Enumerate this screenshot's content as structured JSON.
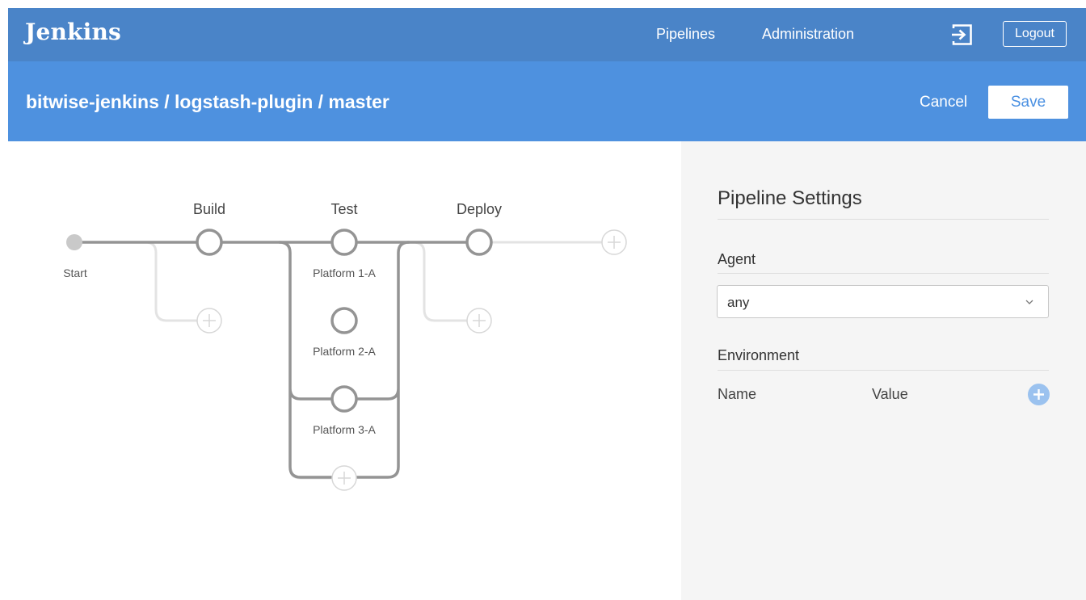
{
  "app": {
    "logo": "Jenkins",
    "nav": {
      "pipelines": "Pipelines",
      "administration": "Administration"
    },
    "logout_label": "Logout",
    "login_icon": "login-arrow-icon"
  },
  "subheader": {
    "breadcrumb": "bitwise-jenkins / logstash-plugin / master",
    "cancel_label": "Cancel",
    "save_label": "Save"
  },
  "pipeline": {
    "start_label": "Start",
    "stages": [
      {
        "name": "Build",
        "branches": []
      },
      {
        "name": "Test",
        "branches": [
          "Platform 1-A",
          "Platform 2-A",
          "Platform 3-A"
        ]
      },
      {
        "name": "Deploy",
        "branches": []
      }
    ]
  },
  "settings": {
    "title": "Pipeline Settings",
    "agent_label": "Agent",
    "agent_value": "any",
    "environment_label": "Environment",
    "columns": {
      "name": "Name",
      "value": "Value"
    },
    "add_icon": "plus-icon"
  },
  "colors": {
    "topbar": "#4a84c8",
    "subheader": "#4e91df",
    "panel": "#f5f5f5",
    "graph_line": "#949494",
    "graph_placeholder": "#e3e3e3"
  }
}
